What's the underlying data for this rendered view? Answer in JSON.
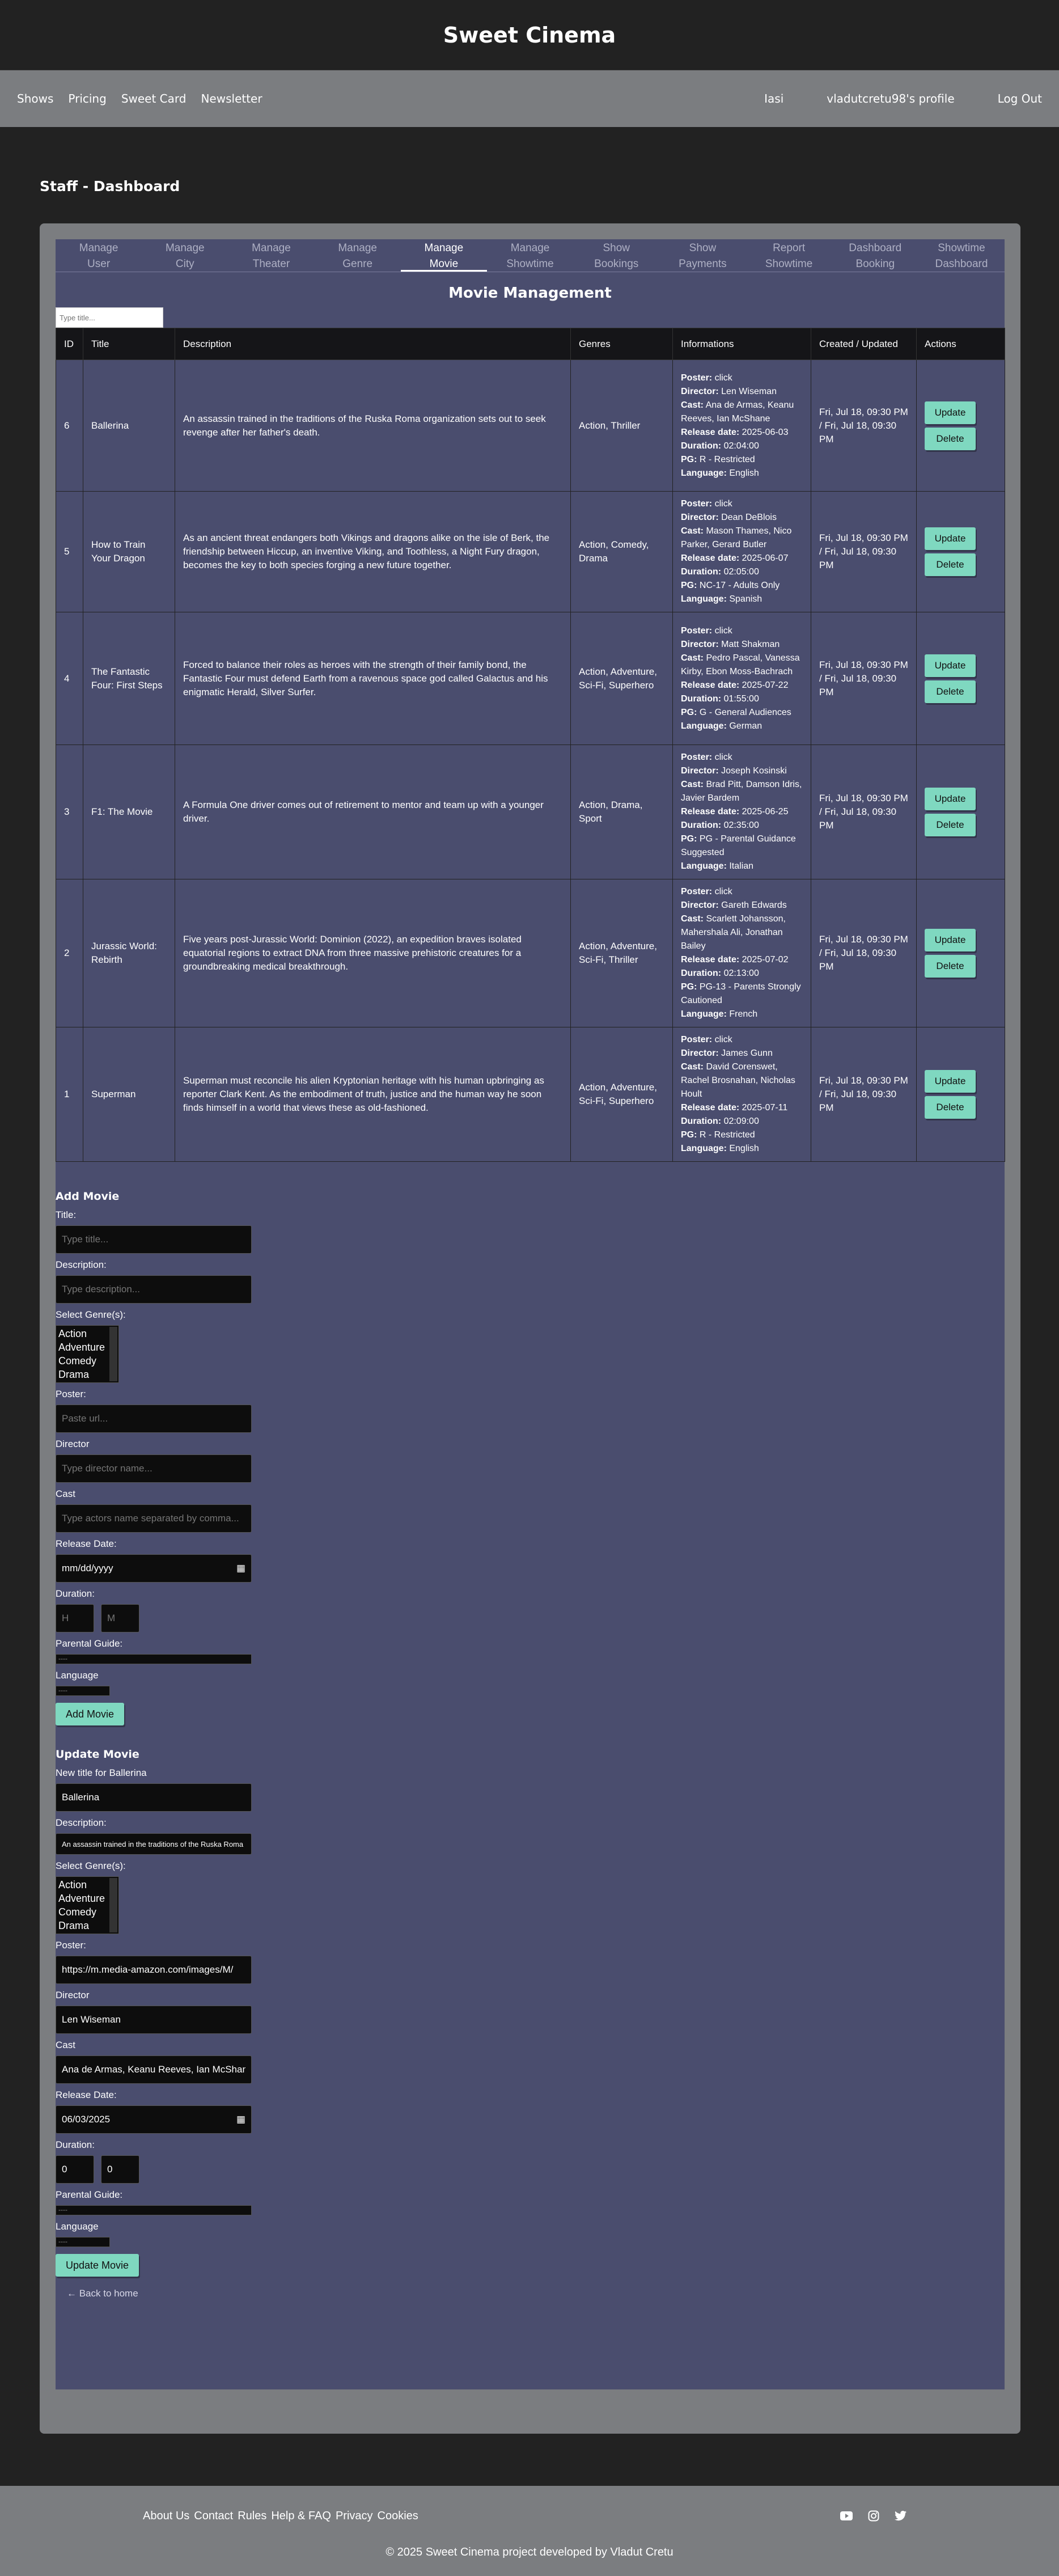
{
  "brand": "Sweet Cinema",
  "nav": {
    "left": [
      "Shows",
      "Pricing",
      "Sweet Card",
      "Newsletter"
    ],
    "city": "Iasi",
    "profile": "vladutcretu98's profile",
    "logout": "Log Out"
  },
  "page_title": "Staff - Dashboard",
  "tabs": [
    {
      "l1": "Manage",
      "l2": "User"
    },
    {
      "l1": "Manage",
      "l2": "City"
    },
    {
      "l1": "Manage",
      "l2": "Theater"
    },
    {
      "l1": "Manage",
      "l2": "Genre"
    },
    {
      "l1": "Manage",
      "l2": "Movie"
    },
    {
      "l1": "Manage",
      "l2": "Showtime"
    },
    {
      "l1": "Show",
      "l2": "Bookings"
    },
    {
      "l1": "Show",
      "l2": "Payments"
    },
    {
      "l1": "Report",
      "l2": "Showtime"
    },
    {
      "l1": "Dashboard",
      "l2": "Booking"
    },
    {
      "l1": "Showtime",
      "l2": "Dashboard"
    }
  ],
  "section_title": "Movie Management",
  "filter_placeholder": "Type title...",
  "table": {
    "headers": [
      "ID",
      "Title",
      "Description",
      "Genres",
      "Informations",
      "Created / Updated",
      "Actions"
    ],
    "labels": {
      "poster": "Poster:",
      "director": "Director:",
      "cast": "Cast:",
      "release": "Release date:",
      "duration": "Duration:",
      "pg": "PG:",
      "language": "Language:"
    },
    "update": "Update",
    "delete": "Delete",
    "rows": [
      {
        "id": "6",
        "title": "Ballerina",
        "desc": "An assassin trained in the traditions of the Ruska Roma organization sets out to seek revenge after her father's death.",
        "genres": "Action, Thriller",
        "poster": "click",
        "director": "Len Wiseman",
        "cast": "Ana de Armas, Keanu Reeves, Ian McShane",
        "release": "2025-06-03",
        "duration": "02:04:00",
        "pg": "R - Restricted",
        "language": "English",
        "created": "Fri, Jul 18, 09:30 PM / Fri, Jul 18, 09:30 PM"
      },
      {
        "id": "5",
        "title": "How to Train Your Dragon",
        "desc": "As an ancient threat endangers both Vikings and dragons alike on the isle of Berk, the friendship between Hiccup, an inventive Viking, and Toothless, a Night Fury dragon, becomes the key to both species forging a new future together.",
        "genres": "Action, Comedy, Drama",
        "poster": "click",
        "director": "Dean DeBlois",
        "cast": "Mason Thames, Nico Parker, Gerard Butler",
        "release": "2025-06-07",
        "duration": "02:05:00",
        "pg": "NC-17 - Adults Only",
        "language": "Spanish",
        "created": "Fri, Jul 18, 09:30 PM / Fri, Jul 18, 09:30 PM"
      },
      {
        "id": "4",
        "title": "The Fantastic Four: First Steps",
        "desc": "Forced to balance their roles as heroes with the strength of their family bond, the Fantastic Four must defend Earth from a ravenous space god called Galactus and his enigmatic Herald, Silver Surfer.",
        "genres": "Action, Adventure, Sci-Fi, Superhero",
        "poster": "click",
        "director": "Matt Shakman",
        "cast": "Pedro Pascal, Vanessa Kirby, Ebon Moss-Bachrach",
        "release": "2025-07-22",
        "duration": "01:55:00",
        "pg": "G - General Audiences",
        "language": "German",
        "created": "Fri, Jul 18, 09:30 PM / Fri, Jul 18, 09:30 PM"
      },
      {
        "id": "3",
        "title": "F1: The Movie",
        "desc": "A Formula One driver comes out of retirement to mentor and team up with a younger driver.",
        "genres": "Action, Drama, Sport",
        "poster": "click",
        "director": "Joseph Kosinski",
        "cast": "Brad Pitt, Damson Idris, Javier Bardem",
        "release": "2025-06-25",
        "duration": "02:35:00",
        "pg": "PG - Parental Guidance Suggested",
        "language": "Italian",
        "created": "Fri, Jul 18, 09:30 PM / Fri, Jul 18, 09:30 PM"
      },
      {
        "id": "2",
        "title": "Jurassic World: Rebirth",
        "desc": "Five years post-Jurassic World: Dominion (2022), an expedition braves isolated equatorial regions to extract DNA from three massive prehistoric creatures for a groundbreaking medical breakthrough.",
        "genres": "Action, Adventure, Sci-Fi, Thriller",
        "poster": "click",
        "director": "Gareth Edwards",
        "cast": "Scarlett Johansson, Mahershala Ali, Jonathan Bailey",
        "release": "2025-07-02",
        "duration": "02:13:00",
        "pg": "PG-13 - Parents Strongly Cautioned",
        "language": "French",
        "created": "Fri, Jul 18, 09:30 PM / Fri, Jul 18, 09:30 PM"
      },
      {
        "id": "1",
        "title": "Superman",
        "desc": "Superman must reconcile his alien Kryptonian heritage with his human upbringing as reporter Clark Kent. As the embodiment of truth, justice and the human way he soon finds himself in a world that views these as old-fashioned.",
        "genres": "Action, Adventure, Sci-Fi, Superhero",
        "poster": "click",
        "director": "James Gunn",
        "cast": "David Corenswet, Rachel Brosnahan, Nicholas Hoult",
        "release": "2025-07-11",
        "duration": "02:09:00",
        "pg": "R - Restricted",
        "language": "English",
        "created": "Fri, Jul 18, 09:30 PM / Fri, Jul 18, 09:30 PM"
      }
    ]
  },
  "genre_options": [
    "Action",
    "Adventure",
    "Comedy",
    "Drama"
  ],
  "add_form": {
    "heading": "Add Movie",
    "title_label": "Title:",
    "title_ph": "Type title...",
    "desc_label": "Description:",
    "desc_ph": "Type description...",
    "genre_label": "Select Genre(s):",
    "poster_label": "Poster:",
    "poster_ph": "Paste url...",
    "director_label": "Director",
    "director_ph": "Type director name...",
    "cast_label": "Cast",
    "cast_ph": "Type actors name separated by comma...",
    "release_label": "Release Date:",
    "release_ph": "mm/dd/yyyy",
    "duration_label": "Duration:",
    "hours_ph": "H",
    "minutes_ph": "M",
    "pg_label": "Parental Guide:",
    "pg_value": "----",
    "lang_label": "Language",
    "lang_value": "----",
    "submit": "Add Movie"
  },
  "update_form": {
    "heading": "Update Movie",
    "title_label": "New title for Ballerina",
    "title_value": "Ballerina",
    "desc_label": "Description:",
    "desc_value": "An assassin trained in the traditions of the Ruska Roma organization sets out to seek revenge after her father's death.",
    "genre_label": "Select Genre(s):",
    "poster_label": "Poster:",
    "poster_value": "https://m.media-amazon.com/images/M/",
    "director_label": "Director",
    "director_value": "Len Wiseman",
    "cast_label": "Cast",
    "cast_value": "Ana de Armas, Keanu Reeves, Ian McShane",
    "release_label": "Release Date:",
    "release_value": "06/03/2025",
    "duration_label": "Duration:",
    "hours_value": "0",
    "minutes_value": "0",
    "pg_label": "Parental Guide:",
    "pg_value": "----",
    "lang_label": "Language",
    "lang_value": "----",
    "submit": "Update Movie"
  },
  "back_link": "← Back to home",
  "footer": {
    "links": [
      "About Us",
      "Contact",
      "Rules",
      "Help & FAQ",
      "Privacy",
      "Cookies"
    ],
    "copyright": "© 2025 Sweet Cinema project developed by Vladut Cretu"
  }
}
